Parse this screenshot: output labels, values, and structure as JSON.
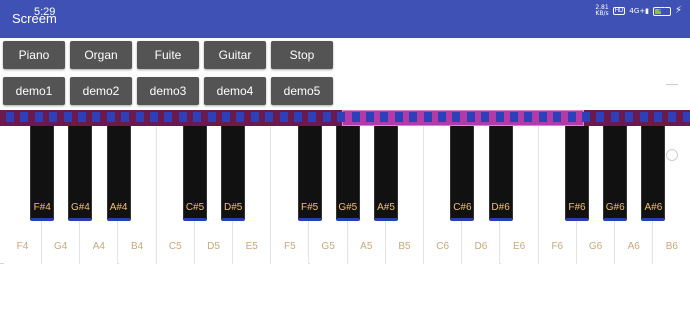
{
  "status_bar": {
    "time": "5:29",
    "net_speed": "2.81",
    "net_unit": "KB/s",
    "hd_badge": "HD",
    "signal_label": "4G+",
    "battery": "44"
  },
  "app_bar": {
    "title": "Screem"
  },
  "instrument_buttons": [
    {
      "label": "Piano",
      "name": "piano-button"
    },
    {
      "label": "Organ",
      "name": "organ-button"
    },
    {
      "label": "Fuite",
      "name": "fuite-button"
    },
    {
      "label": "Guitar",
      "name": "guitar-button"
    },
    {
      "label": "Stop",
      "name": "stop-button"
    }
  ],
  "demo_buttons": [
    {
      "label": "demo1",
      "name": "demo1-button"
    },
    {
      "label": "demo2",
      "name": "demo2-button"
    },
    {
      "label": "demo3",
      "name": "demo3-button"
    },
    {
      "label": "demo4",
      "name": "demo4-button"
    },
    {
      "label": "demo5",
      "name": "demo5-button"
    }
  ],
  "keyboard": {
    "white_keys": [
      "F4",
      "G4",
      "A4",
      "B4",
      "C5",
      "D5",
      "E5",
      "F5",
      "G5",
      "A5",
      "B5",
      "C6",
      "D6",
      "E6",
      "F6",
      "G6",
      "A6",
      "B6"
    ],
    "black_keys": [
      "F#4",
      "G#4",
      "A#4",
      "C#5",
      "D#5",
      "F#5",
      "G#5",
      "A#5",
      "C#6",
      "D#6",
      "F#6",
      "G#6",
      "A#6"
    ]
  },
  "colors": {
    "app_bar": "#3f51b5",
    "button_bg": "#545454",
    "strip_bg": "#6a1a4c",
    "strip_highlight": "#b43aa8",
    "key_marker": "#2740b5",
    "white_key_label": "#c9a87a",
    "black_key_label": "#f0c070"
  }
}
